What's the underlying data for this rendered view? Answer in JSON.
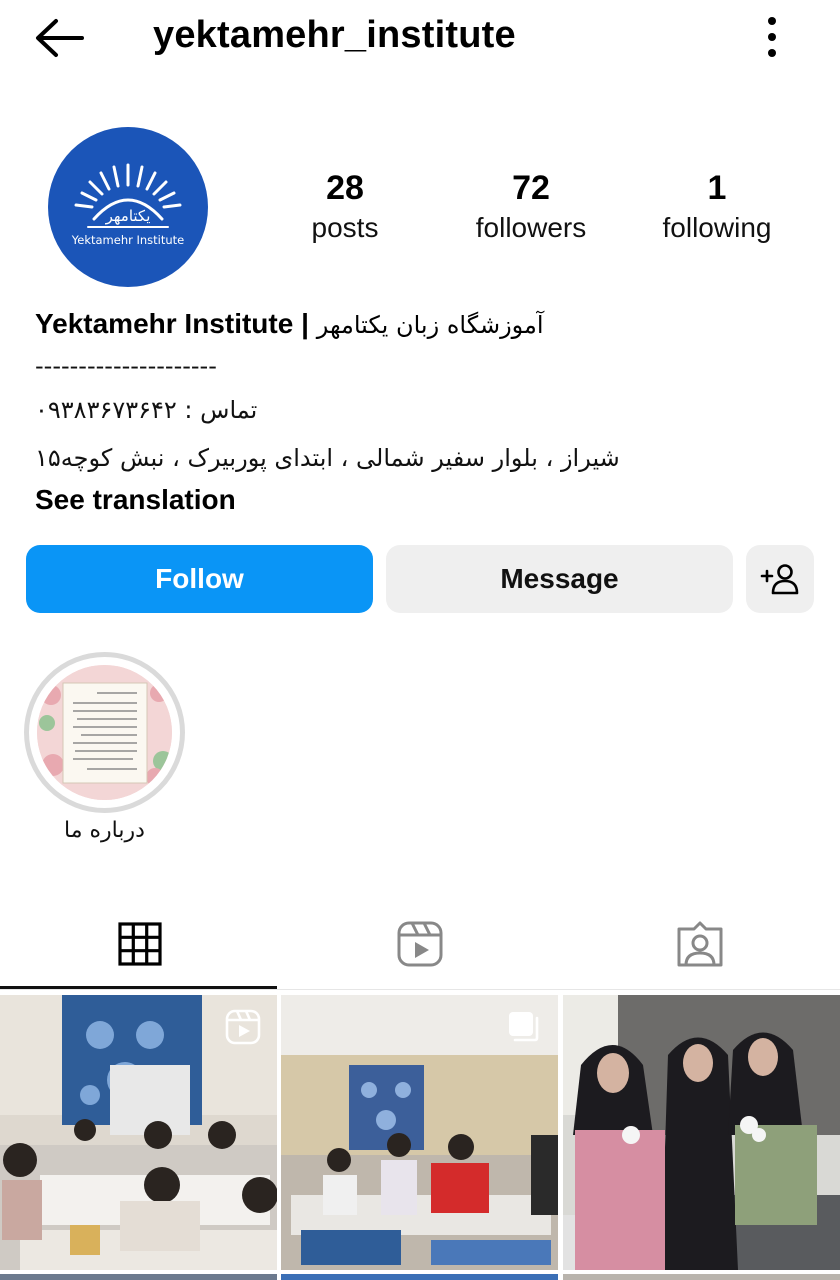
{
  "header": {
    "username": "yektamehr_institute",
    "back_icon": "arrow-left-icon",
    "more_icon": "vertical-dots-icon"
  },
  "profile": {
    "avatar_text_fa": "یکتامهر",
    "avatar_text_en": "Yektamehr Institute",
    "stats": [
      {
        "value": "28",
        "label": "posts"
      },
      {
        "value": "72",
        "label": "followers"
      },
      {
        "value": "1",
        "label": "following"
      }
    ]
  },
  "bio": {
    "name_en": "Yektamehr Institute |",
    "name_fa": "آموزشگاه زبان یکتامهر",
    "separator": "---------------------",
    "contact": "تماس : ۰۹۳۸۳۶۷۳۶۴۲",
    "address": "شیراز ، بلوار سفیر شمالی ، ابتدای پوربیرک ، نبش کوچه۱۵",
    "see_translation": "See translation"
  },
  "actions": {
    "follow": "Follow",
    "message": "Message",
    "add_user_icon": "add-user-icon"
  },
  "highlights": [
    {
      "label": "درباره ما"
    }
  ],
  "tabs": [
    {
      "icon": "grid-icon",
      "active": true
    },
    {
      "icon": "reels-icon",
      "active": false
    },
    {
      "icon": "tagged-icon",
      "active": false
    }
  ],
  "posts": [
    {
      "badge": "reels-icon"
    },
    {
      "badge": "carousel-icon"
    },
    {
      "badge": ""
    }
  ],
  "colors": {
    "follow_blue": "#0a95f6",
    "avatar_blue": "#1b55b8",
    "button_gray": "#efefef"
  }
}
